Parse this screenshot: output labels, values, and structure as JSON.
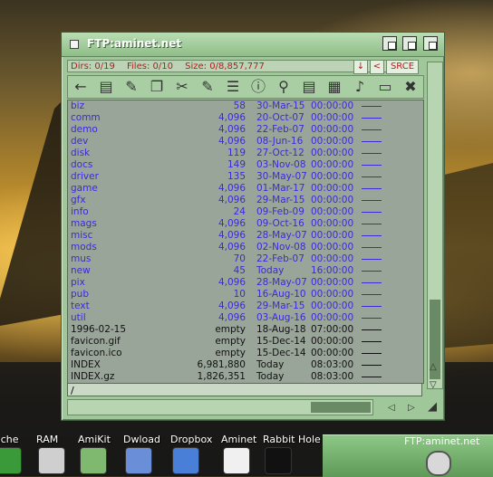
{
  "window": {
    "title": "FTP:aminet.net",
    "status": {
      "dirs": "Dirs: 0/19",
      "files": "Files: 0/10",
      "size": "Size: 0/8,857,777"
    },
    "buttons": {
      "down": "↓",
      "back": "<",
      "source": "SRCE"
    },
    "path": "/",
    "toolbar_icons": [
      "back-arrow-icon",
      "list-icon",
      "edit-icon",
      "copy-icon",
      "cut-icon",
      "paste-icon",
      "menu-icon",
      "info-icon",
      "search-icon",
      "text-icon",
      "grid-icon",
      "audio-icon",
      "trash-icon",
      "close-icon"
    ],
    "entries": [
      {
        "name": "biz",
        "size": "58",
        "date": "30-Mar-15",
        "time": "00:00:00",
        "type": "dir"
      },
      {
        "name": "comm",
        "size": "4,096",
        "date": "20-Oct-07",
        "time": "00:00:00",
        "type": "dir"
      },
      {
        "name": "demo",
        "size": "4,096",
        "date": "22-Feb-07",
        "time": "00:00:00",
        "type": "dir"
      },
      {
        "name": "dev",
        "size": "4,096",
        "date": "08-Jun-16",
        "time": "00:00:00",
        "type": "dir"
      },
      {
        "name": "disk",
        "size": "119",
        "date": "27-Oct-12",
        "time": "00:00:00",
        "type": "dir"
      },
      {
        "name": "docs",
        "size": "149",
        "date": "03-Nov-08",
        "time": "00:00:00",
        "type": "dir"
      },
      {
        "name": "driver",
        "size": "135",
        "date": "30-May-07",
        "time": "00:00:00",
        "type": "dir"
      },
      {
        "name": "game",
        "size": "4,096",
        "date": "01-Mar-17",
        "time": "00:00:00",
        "type": "dir"
      },
      {
        "name": "gfx",
        "size": "4,096",
        "date": "29-Mar-15",
        "time": "00:00:00",
        "type": "dir"
      },
      {
        "name": "info",
        "size": "24",
        "date": "09-Feb-09",
        "time": "00:00:00",
        "type": "dir"
      },
      {
        "name": "mags",
        "size": "4,096",
        "date": "09-Oct-16",
        "time": "00:00:00",
        "type": "dir"
      },
      {
        "name": "misc",
        "size": "4,096",
        "date": "28-May-07",
        "time": "00:00:00",
        "type": "dir"
      },
      {
        "name": "mods",
        "size": "4,096",
        "date": "02-Nov-08",
        "time": "00:00:00",
        "type": "dir"
      },
      {
        "name": "mus",
        "size": "70",
        "date": "22-Feb-07",
        "time": "00:00:00",
        "type": "dir"
      },
      {
        "name": "new",
        "size": "45",
        "date": "Today",
        "time": "16:00:00",
        "type": "dir"
      },
      {
        "name": "pix",
        "size": "4,096",
        "date": "28-May-07",
        "time": "00:00:00",
        "type": "dir"
      },
      {
        "name": "pub",
        "size": "10",
        "date": "16-Aug-10",
        "time": "00:00:00",
        "type": "dir"
      },
      {
        "name": "text",
        "size": "4,096",
        "date": "29-Mar-15",
        "time": "00:00:00",
        "type": "dir"
      },
      {
        "name": "util",
        "size": "4,096",
        "date": "03-Aug-16",
        "time": "00:00:00",
        "type": "dir"
      },
      {
        "name": "1996-02-15",
        "size": "empty",
        "date": "18-Aug-18",
        "time": "07:00:00",
        "type": "file"
      },
      {
        "name": "favicon.gif",
        "size": "empty",
        "date": "15-Dec-14",
        "time": "00:00:00",
        "type": "file"
      },
      {
        "name": "favicon.ico",
        "size": "empty",
        "date": "15-Dec-14",
        "time": "00:00:00",
        "type": "file"
      },
      {
        "name": "INDEX",
        "size": "6,981,880",
        "date": "Today",
        "time": "08:03:00",
        "type": "file"
      },
      {
        "name": "INDEX.gz",
        "size": "1,826,351",
        "date": "Today",
        "time": "08:03:00",
        "type": "file"
      }
    ]
  },
  "dock": {
    "items": [
      "ache",
      "RAM",
      "AmiKit",
      "Dwload",
      "Dropbox",
      "Aminet",
      "Rabbit Hole"
    ],
    "active_label": "FTP:aminet.net"
  }
}
